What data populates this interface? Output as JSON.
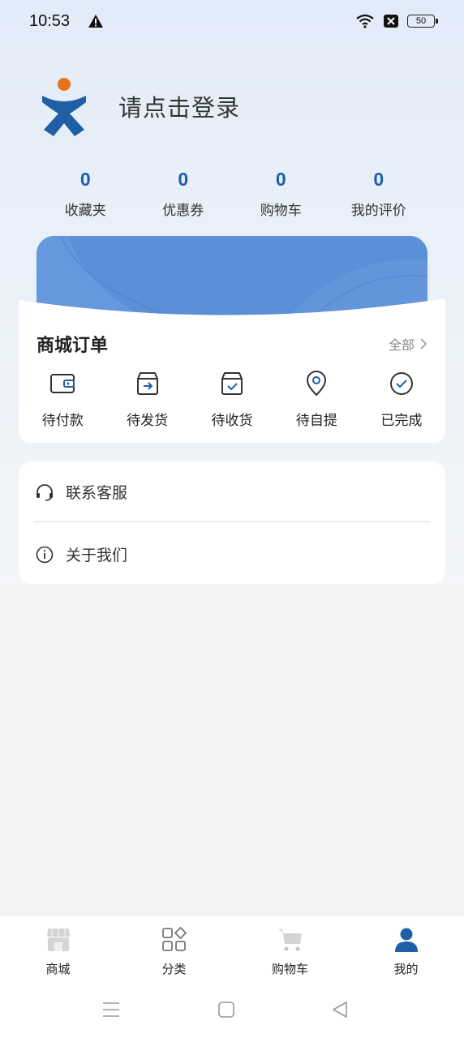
{
  "status_bar": {
    "time": "10:53",
    "battery": "50",
    "icons": [
      "alert-icon",
      "wifi-icon",
      "sim-off-icon",
      "battery-icon"
    ]
  },
  "profile": {
    "login_prompt": "请点击登录",
    "logo": "brand-logo"
  },
  "stats": [
    {
      "count": "0",
      "label": "收藏夹"
    },
    {
      "count": "0",
      "label": "优惠券"
    },
    {
      "count": "0",
      "label": "购物车"
    },
    {
      "count": "0",
      "label": "我的评价"
    }
  ],
  "orders": {
    "title": "商城订单",
    "view_all": "全部",
    "items": [
      {
        "label": "待付款",
        "icon": "wallet-icon"
      },
      {
        "label": "待发货",
        "icon": "box-ship-icon"
      },
      {
        "label": "待收货",
        "icon": "box-check-icon"
      },
      {
        "label": "待自提",
        "icon": "location-pin-icon"
      },
      {
        "label": "已完成",
        "icon": "check-circle-icon"
      }
    ]
  },
  "menu": [
    {
      "label": "联系客服",
      "icon": "headset-icon"
    },
    {
      "label": "关于我们",
      "icon": "info-icon"
    }
  ],
  "tabbar": [
    {
      "label": "商城",
      "icon": "store-icon",
      "active": false
    },
    {
      "label": "分类",
      "icon": "category-icon",
      "active": false
    },
    {
      "label": "购物车",
      "icon": "cart-icon",
      "active": false
    },
    {
      "label": "我的",
      "icon": "user-icon",
      "active": true
    }
  ],
  "colors": {
    "accent": "#1f5fa6",
    "banner": "#5b8fd6",
    "logo_orange": "#e8731f",
    "logo_blue": "#1f5fa6"
  }
}
